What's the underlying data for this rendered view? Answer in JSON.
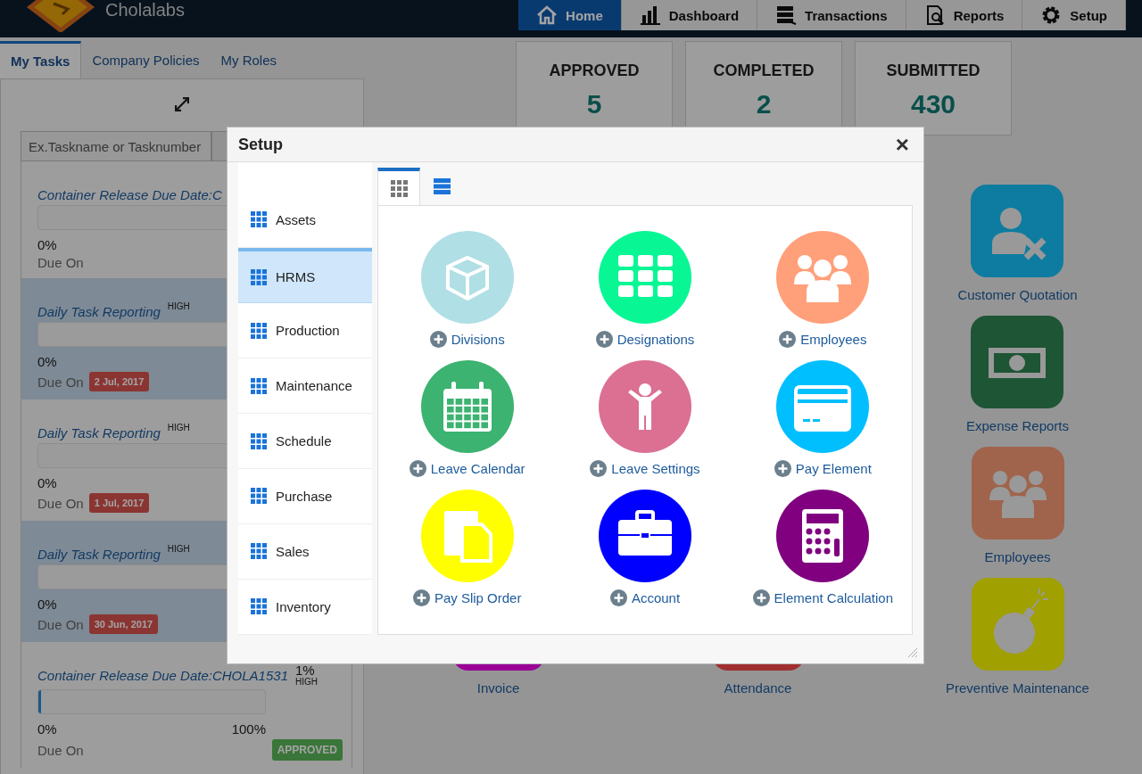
{
  "header": {
    "brand": "Cholalabs",
    "nav": [
      {
        "label": "Home",
        "selected": true
      },
      {
        "label": "Dashboard",
        "selected": false
      },
      {
        "label": "Transactions",
        "selected": false
      },
      {
        "label": "Reports",
        "selected": false
      },
      {
        "label": "Setup",
        "selected": false
      }
    ]
  },
  "tasks_panel": {
    "tabs": [
      {
        "label": "My Tasks",
        "selected": true
      },
      {
        "label": "Company Policies",
        "selected": false
      },
      {
        "label": "My Roles",
        "selected": false
      }
    ],
    "search": {
      "placeholder": "Ex.Taskname or Tasknumber"
    },
    "tasks": [
      {
        "title": "Container Release Due Date:C",
        "highlighted": false,
        "percent": "0%",
        "due_label": "Due On"
      },
      {
        "title": "Daily Task Reporting",
        "priority": "HIGH",
        "highlighted": true,
        "percent": "0%",
        "due_label": "Due On",
        "due_date": "2 Jul, 2017"
      },
      {
        "title": "Daily Task Reporting",
        "priority": "HIGH",
        "highlighted": false,
        "percent": "0%",
        "due_label": "Due On",
        "due_date": "1 Jul, 2017"
      },
      {
        "title": "Daily Task Reporting",
        "priority": "HIGH",
        "highlighted": true,
        "percent": "0%",
        "due_label": "Due On",
        "due_date": "30 Jun, 2017"
      },
      {
        "title": "Container Release Due Date:CHOLA1531",
        "priority": "HIGH",
        "progress_label": "1%",
        "highlighted": false,
        "level": 0.01,
        "percent": "0%",
        "end_percent": "100%",
        "due_label": "Due On",
        "status": "APPROVED"
      }
    ]
  },
  "stats": [
    {
      "label": "APPROVED",
      "value": "5"
    },
    {
      "label": "COMPLETED",
      "value": "2"
    },
    {
      "label": "SUBMITTED",
      "value": "430"
    }
  ],
  "tile_columns": [
    [
      {
        "label": "Invoice",
        "kind": "hidden",
        "color": "#9a0096"
      }
    ],
    [
      {
        "label": "Attendance",
        "kind": "hidden",
        "color": "#a03030"
      }
    ],
    [
      {
        "label": "Customer Quotation",
        "kind": "user-x",
        "color": "#0e7ca0"
      },
      {
        "label": "Expense Reports",
        "kind": "banknote",
        "color": "#1e5535"
      },
      {
        "label": "Employees",
        "kind": "people",
        "color": "#a0644c"
      },
      {
        "label": "Preventive Maintenance",
        "kind": "bomb",
        "color": "#a0a000"
      }
    ]
  ],
  "modal": {
    "title": "Setup",
    "close": "×",
    "categories": [
      {
        "label": "Assets",
        "selected": false
      },
      {
        "label": "HRMS",
        "selected": true
      },
      {
        "label": "Production",
        "selected": false
      },
      {
        "label": "Maintenance",
        "selected": false
      },
      {
        "label": "Schedule",
        "selected": false
      },
      {
        "label": "Purchase",
        "selected": false
      },
      {
        "label": "Sales",
        "selected": false
      },
      {
        "label": "Inventory",
        "selected": false
      }
    ],
    "views": [
      {
        "kind": "grid",
        "selected": true
      },
      {
        "kind": "list",
        "selected": false
      }
    ],
    "items": [
      {
        "label": "Divisions",
        "kind": "cube",
        "color": "#b0dfe5"
      },
      {
        "label": "Designations",
        "kind": "grid",
        "color": "#08f794"
      },
      {
        "label": "Employees",
        "kind": "people",
        "color": "#ffa07a"
      },
      {
        "label": "Leave Calendar",
        "kind": "calendar",
        "color": "#3cb371"
      },
      {
        "label": "Leave Settings",
        "kind": "person",
        "color": "#db7093"
      },
      {
        "label": "Pay Element",
        "kind": "card",
        "color": "#00bfff"
      },
      {
        "label": "Pay Slip Order",
        "kind": "document",
        "color": "#ffff00"
      },
      {
        "label": "Account",
        "kind": "briefcase",
        "color": "#0000ff"
      },
      {
        "label": "Element Calculation",
        "kind": "calculator",
        "color": "#800080"
      }
    ]
  }
}
